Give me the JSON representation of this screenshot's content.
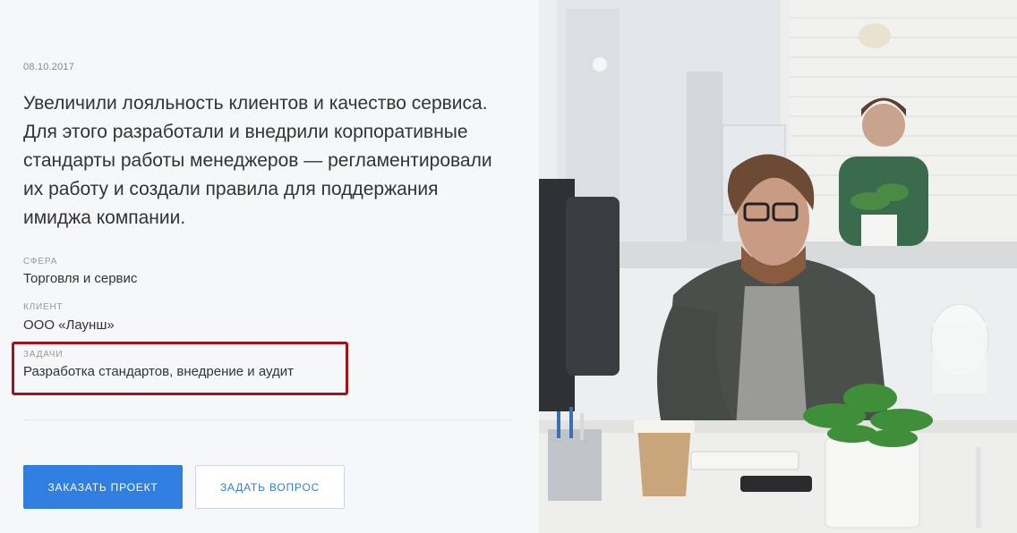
{
  "project": {
    "date": "08.10.2017",
    "headline": "Увеличили лояльность клиентов и качество сервиса. Для этого разработали и внедрили корпоративные стандарты работы менеджеров — регламентировали их работу и создали правила для поддержания имиджа компании."
  },
  "meta": [
    {
      "label": "СФЕРА",
      "value": "Торговля и сервис"
    },
    {
      "label": "КЛИЕНТ",
      "value": "ООО «Лаунш»"
    },
    {
      "label": "ЗАДАЧИ",
      "value": "Разработка стандартов, внедрение и аудит"
    }
  ],
  "actions": {
    "order_label": "ЗАКАЗАТЬ ПРОЕКТ",
    "ask_label": "ЗАДАТЬ ВОПРОС"
  },
  "colors": {
    "accent": "#2f7ee0",
    "highlight_border": "#a51019"
  },
  "image": {
    "subject": "office-workers-photo"
  }
}
